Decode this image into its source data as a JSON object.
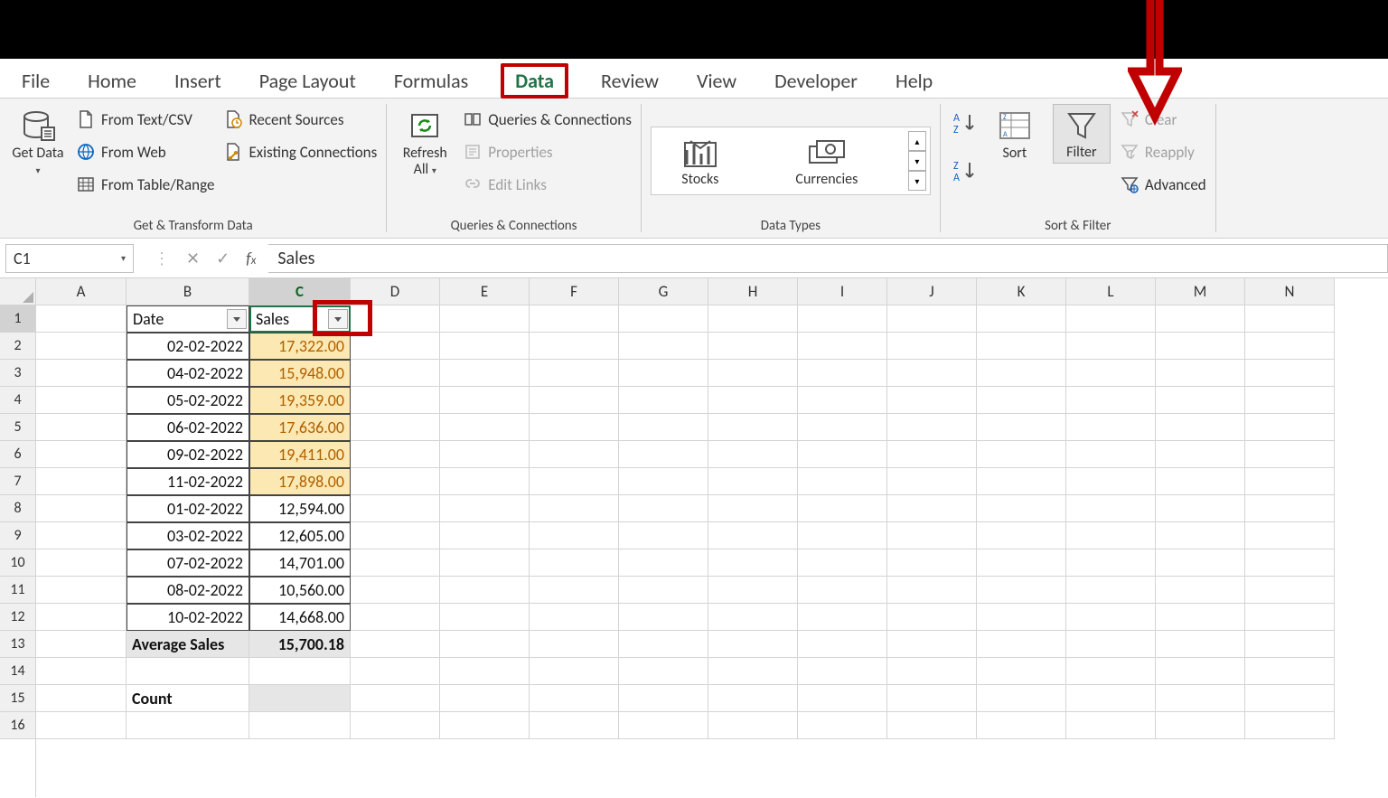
{
  "tabs": {
    "file": "File",
    "home": "Home",
    "insert": "Insert",
    "page_layout": "Page Layout",
    "formulas": "Formulas",
    "data": "Data",
    "review": "Review",
    "view": "View",
    "developer": "Developer",
    "help": "Help"
  },
  "ribbon": {
    "get_data": "Get Data",
    "from_text": "From Text/CSV",
    "from_web": "From Web",
    "from_table": "From Table/Range",
    "recent_sources": "Recent Sources",
    "existing_conn": "Existing Connections",
    "group1_label": "Get & Transform Data",
    "refresh_all": "Refresh All",
    "queries": "Queries & Connections",
    "properties": "Properties",
    "edit_links": "Edit Links",
    "group2_label": "Queries & Connections",
    "stocks": "Stocks",
    "currencies": "Currencies",
    "group3_label": "Data Types",
    "sort": "Sort",
    "filter": "Filter",
    "clear": "Clear",
    "reapply": "Reapply",
    "advanced": "Advanced",
    "group4_label": "Sort & Filter"
  },
  "formula_bar": {
    "name_box": "C1",
    "formula": "Sales"
  },
  "columns": [
    "A",
    "B",
    "C",
    "D",
    "E",
    "F",
    "G",
    "H",
    "I",
    "J",
    "K",
    "L",
    "M",
    "N"
  ],
  "rows": [
    1,
    2,
    3,
    4,
    5,
    6,
    7,
    8,
    9,
    10,
    11,
    12,
    13,
    14,
    15,
    16
  ],
  "table": {
    "header_date": "Date",
    "header_sales": "Sales",
    "data": [
      {
        "date": "02-02-2022",
        "sales": "17,322.00",
        "hl": true
      },
      {
        "date": "04-02-2022",
        "sales": "15,948.00",
        "hl": true
      },
      {
        "date": "05-02-2022",
        "sales": "19,359.00",
        "hl": true
      },
      {
        "date": "06-02-2022",
        "sales": "17,636.00",
        "hl": true
      },
      {
        "date": "09-02-2022",
        "sales": "19,411.00",
        "hl": true
      },
      {
        "date": "11-02-2022",
        "sales": "17,898.00",
        "hl": true
      },
      {
        "date": "01-02-2022",
        "sales": "12,594.00",
        "hl": false
      },
      {
        "date": "03-02-2022",
        "sales": "12,605.00",
        "hl": false
      },
      {
        "date": "07-02-2022",
        "sales": "14,701.00",
        "hl": false
      },
      {
        "date": "08-02-2022",
        "sales": "10,560.00",
        "hl": false
      },
      {
        "date": "10-02-2022",
        "sales": "14,668.00",
        "hl": false
      }
    ],
    "avg_label": "Average Sales",
    "avg_value": "15,700.18",
    "count_label": "Count"
  }
}
